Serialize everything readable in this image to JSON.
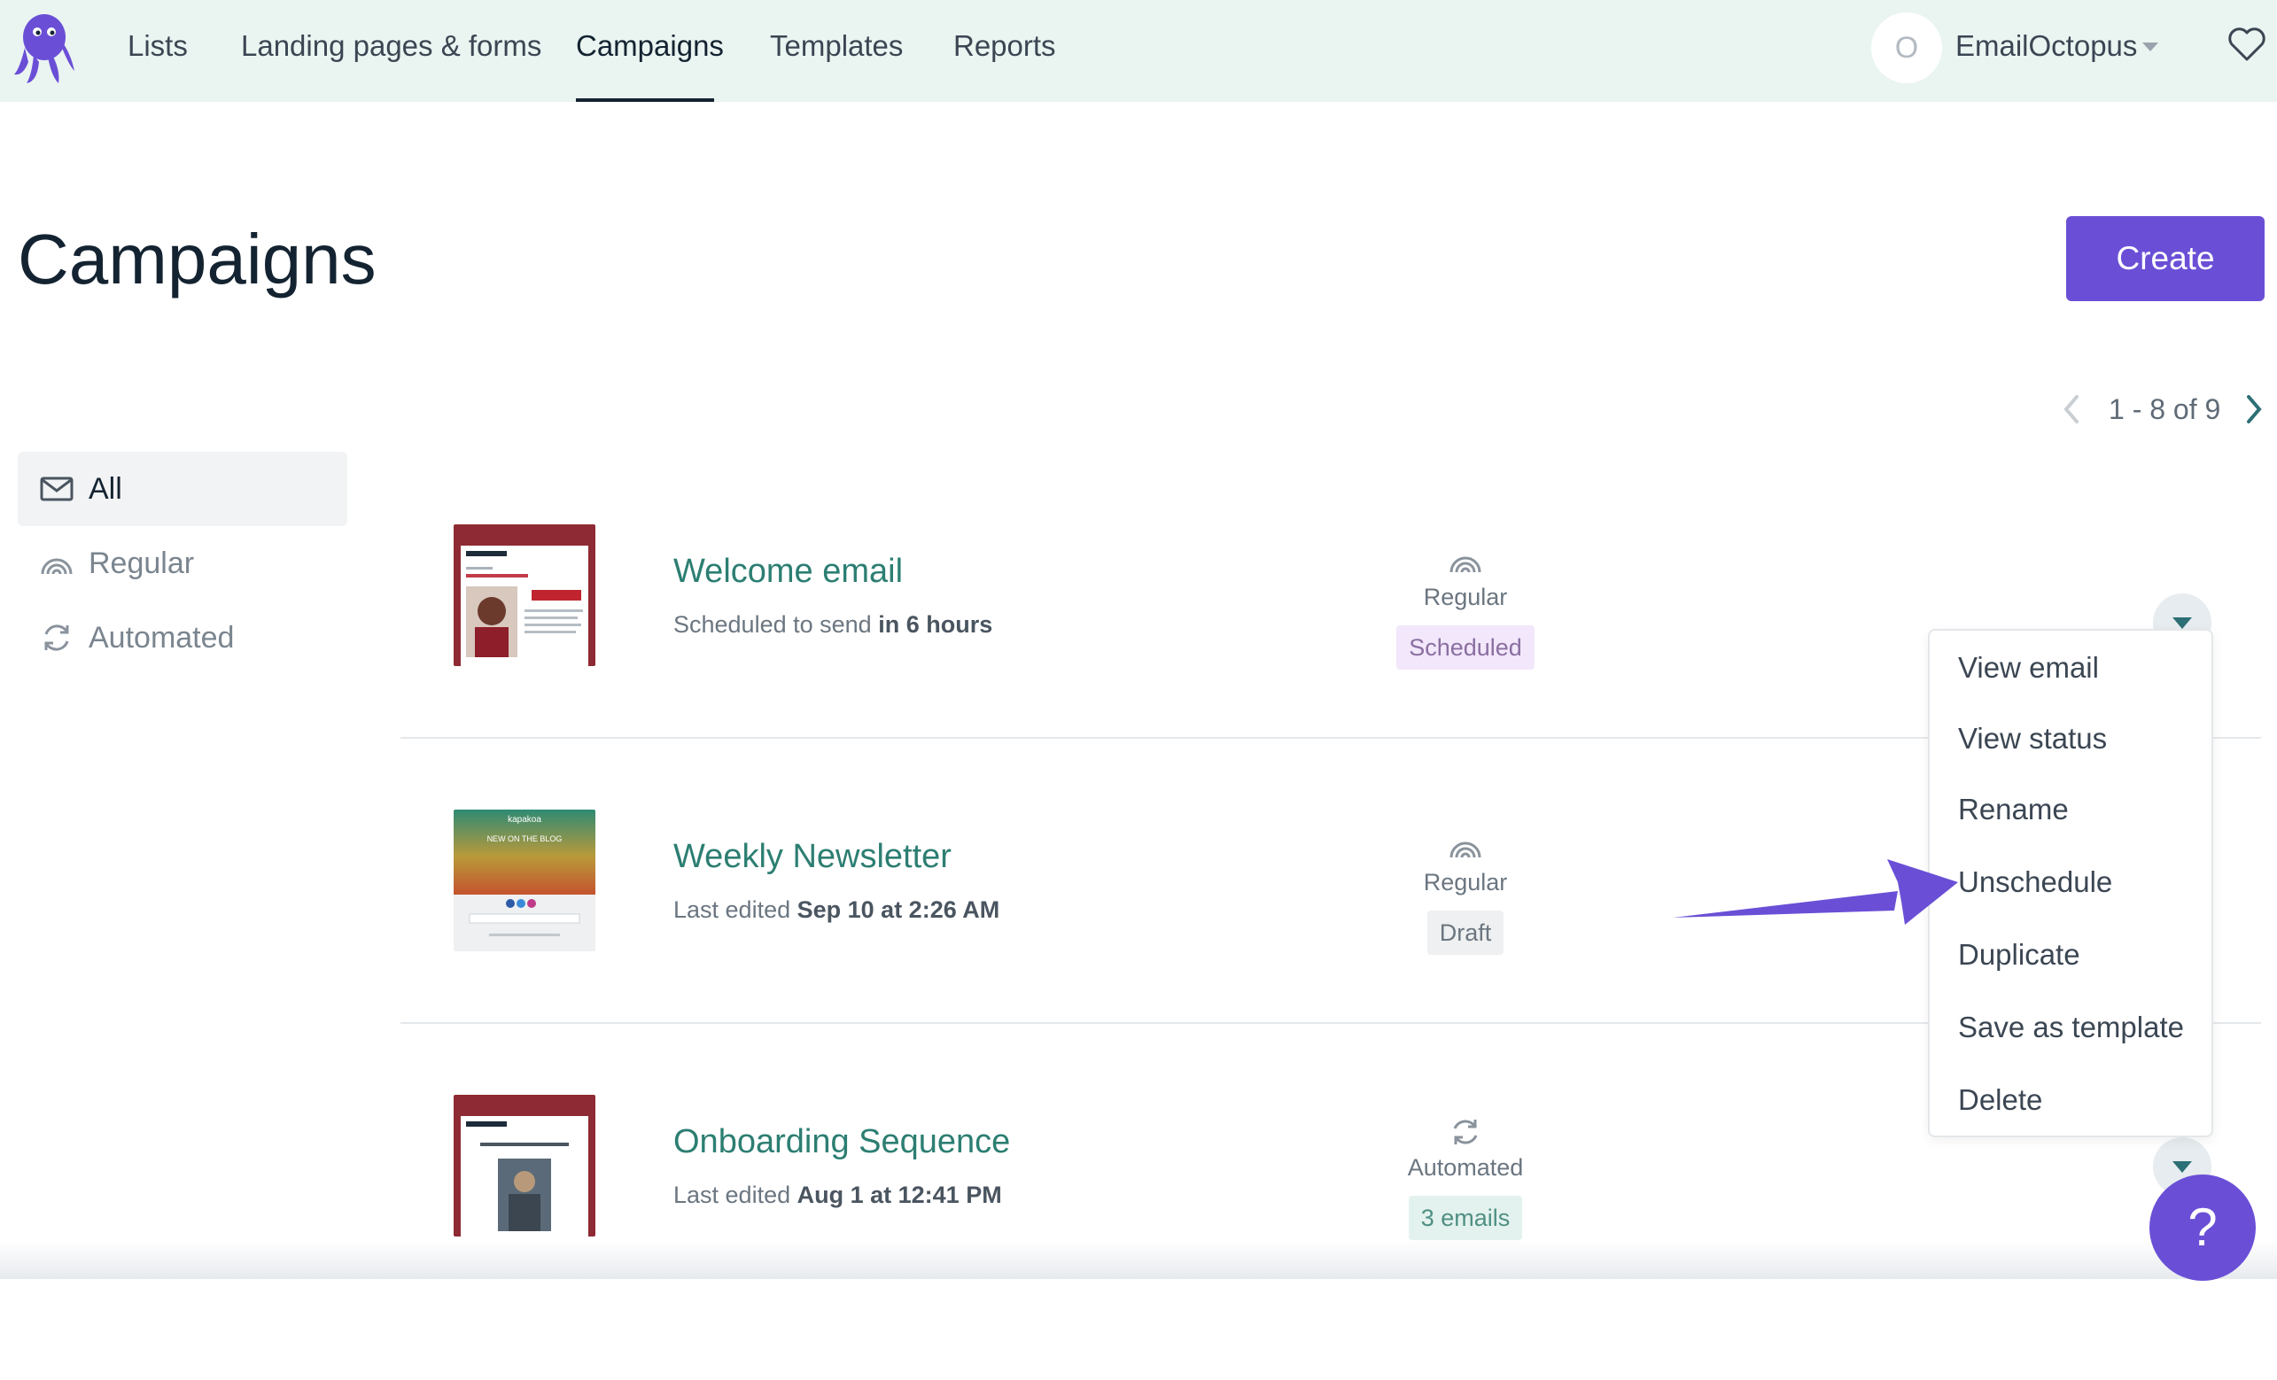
{
  "nav": {
    "tabs": [
      {
        "label": "Lists"
      },
      {
        "label": "Landing pages & forms"
      },
      {
        "label": "Campaigns"
      },
      {
        "label": "Templates"
      },
      {
        "label": "Reports"
      }
    ],
    "active_tab": "Campaigns",
    "avatar_initial": "O",
    "account_name": "EmailOctopus"
  },
  "header": {
    "title": "Campaigns",
    "create_label": "Create"
  },
  "pager": {
    "range_text": "1 - 8 of 9"
  },
  "filters": [
    {
      "label": "All",
      "icon": "envelope-icon",
      "active": true
    },
    {
      "label": "Regular",
      "icon": "rainbow-icon",
      "active": false
    },
    {
      "label": "Automated",
      "icon": "refresh-icon",
      "active": false
    }
  ],
  "campaigns": [
    {
      "name": "Welcome email",
      "meta_prefix": "Scheduled to send",
      "meta_emphasis": "in 6 hours",
      "type": "Regular",
      "type_icon": "rainbow-icon",
      "badge": "Scheduled"
    },
    {
      "name": "Weekly Newsletter",
      "meta_prefix": "Last edited",
      "meta_emphasis": "Sep 10 at 2:26 AM",
      "type": "Regular",
      "type_icon": "rainbow-icon",
      "badge": "Draft",
      "thumb_text": "kapakoa",
      "thumb_subtext": "NEW ON THE BLOG"
    },
    {
      "name": "Onboarding Sequence",
      "meta_prefix": "Last edited",
      "meta_emphasis": "Aug 1 at 12:41 PM",
      "type": "Automated",
      "type_icon": "refresh-icon",
      "badge": "3 emails"
    }
  ],
  "menu": {
    "items": [
      {
        "label": "View email"
      },
      {
        "label": "View status"
      },
      {
        "label": "Rename"
      },
      {
        "label": "Unschedule"
      },
      {
        "label": "Duplicate"
      },
      {
        "label": "Save as template"
      },
      {
        "label": "Delete"
      }
    ]
  },
  "help": {
    "label": "?"
  },
  "colors": {
    "brand_purple": "#6a4fd6",
    "nav_bg": "#eaf4f1",
    "link_teal": "#2c7e72",
    "scheduled_badge_bg": "#f3e7fb"
  }
}
